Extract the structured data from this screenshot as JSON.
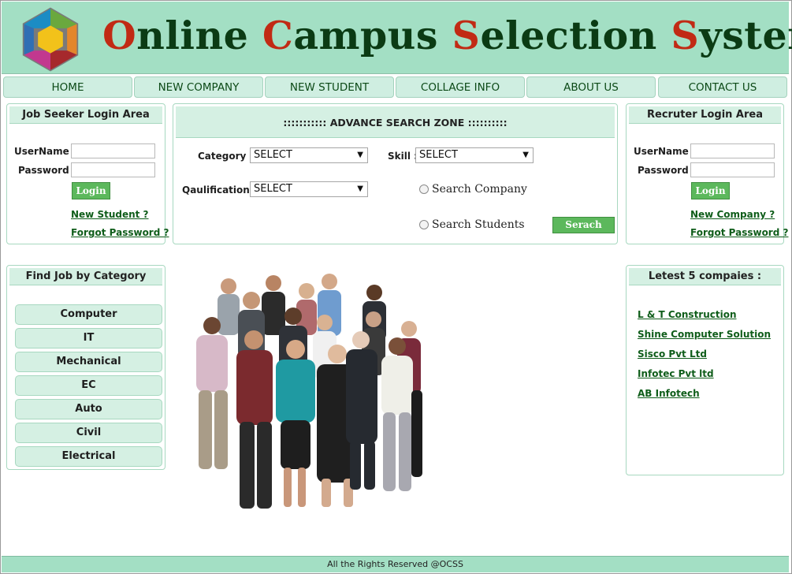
{
  "header": {
    "title_parts": [
      {
        "cap": "O",
        "rest": "nline "
      },
      {
        "cap": "C",
        "rest": "ampus "
      },
      {
        "cap": "S",
        "rest": "election "
      },
      {
        "cap": "S",
        "rest": "ystem"
      }
    ],
    "logo_colors": [
      "#e7b21c",
      "#6a9a3c",
      "#2c5e9e",
      "#c0392b",
      "#e67e22",
      "#8e44ad"
    ]
  },
  "nav": [
    "HOME",
    "NEW COMPANY",
    "NEW STUDENT",
    "COLLAGE INFO",
    "ABOUT US",
    "CONTACT US"
  ],
  "job_seeker": {
    "title": "Job Seeker Login Area",
    "username_label": "UserName :",
    "password_label": "Password :",
    "login_label": "Login",
    "new_link": "New Student ?",
    "forgot_link": "Forgot Password ?"
  },
  "search": {
    "title": ":::::::::::   ADVANCE SEARCH ZONE   ::::::::::",
    "category_label": "Category  :",
    "category_value": "SELECT",
    "skill_label": "Skill :",
    "skill_value": "SELECT",
    "qualification_label": "Qaulification :",
    "qualification_value": "SELECT",
    "radio_company": "Search Company",
    "radio_students": "Search Students",
    "search_button": "Serach"
  },
  "recruiter": {
    "title": "Recruter Login Area",
    "username_label": "UserName :",
    "password_label": "Password :",
    "login_label": "Login",
    "new_link": "New Company ?",
    "forgot_link": "Forgot Password ?"
  },
  "categories": {
    "title": "Find Job by Category",
    "items": [
      "Computer",
      "IT",
      "Mechanical",
      "EC",
      "Auto",
      "Civil",
      "Electrical"
    ]
  },
  "companies": {
    "title": "Letest 5 compaies :",
    "items": [
      "L & T Construction",
      "Shine Computer Solution",
      "Sisco Pvt Ltd",
      "Infotec Pvt ltd",
      "AB Infotech"
    ]
  },
  "footer": "All the Rights Reserved @OCSS",
  "colors": {
    "header_bg": "#a3dfc4",
    "title_green": "#0b3b14",
    "title_red": "#c12a14",
    "button_green": "#5cb85c",
    "link_green": "#0f5d1a"
  }
}
